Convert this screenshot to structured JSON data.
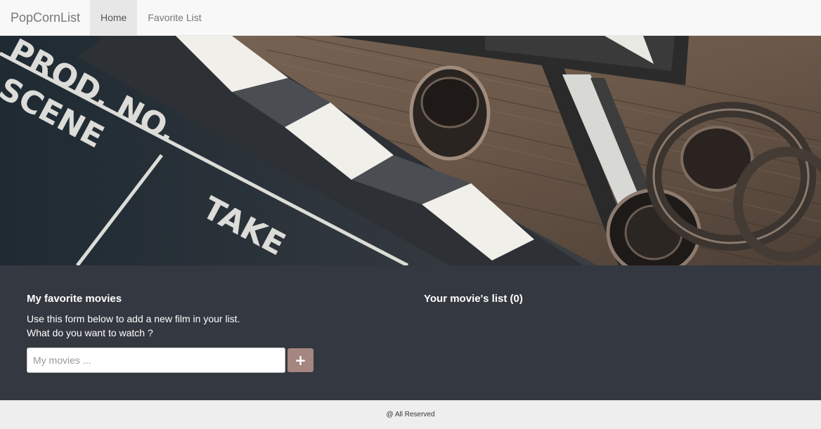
{
  "navbar": {
    "brand": "PopCornList",
    "items": [
      {
        "label": "Home",
        "active": true
      },
      {
        "label": "Favorite List",
        "active": false
      }
    ]
  },
  "hero": {
    "clapper_text": [
      "PROD. NO.",
      "SCENE",
      "TAKE"
    ]
  },
  "main": {
    "left": {
      "title": "My favorite movies",
      "description_line1": "Use this form below to add a new film in your list.",
      "description_line2": "What do you want to watch ?",
      "input_placeholder": "My movies ...",
      "input_value": "",
      "add_button_icon": "plus-icon",
      "add_button_glyph": "+"
    },
    "right": {
      "title": "Your movie's list (0)"
    }
  },
  "footer": {
    "text": "@ All Reserved"
  },
  "colors": {
    "navbar_bg": "#f8f8f8",
    "main_bg": "#343840",
    "add_button_bg": "#a58680",
    "footer_bg": "#eeeeee"
  }
}
